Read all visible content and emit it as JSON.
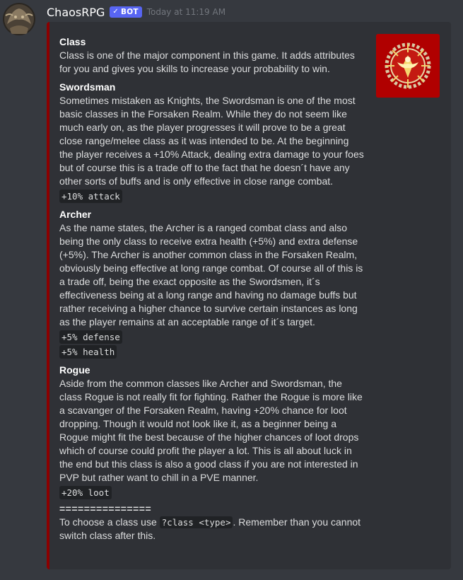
{
  "message": {
    "username": "ChaosRPG",
    "bot_tag": "BOT",
    "timestamp": "Today at 11:19 AM"
  },
  "embed": {
    "accent_color": "#8b0000",
    "thumbnail_icon": "golden-sun-emblem",
    "fields": [
      {
        "name": "Class",
        "value": "Class is one of the major component in this game. It adds attributes for you and gives you skills to increase your probability to win."
      },
      {
        "name": "Swordsman",
        "value": "Sometimes mistaken as Knights, the Swordsman is one of the most basic classes in the Forsaken Realm. While they do not seem like much early on, as the player progresses it will prove to be a great close range/melee class as it was intended to be. At the beginning the player receives a +10% Attack, dealing extra damage to your foes but of course this is a trade off to the fact that he doesn´t have any other sorts of buffs and is only effective in close range combat.",
        "codes": [
          "+10% attack"
        ]
      },
      {
        "name": "Archer",
        "value": "As the name states, the Archer is a ranged combat class and also being the only class to receive extra health (+5%) and extra defense (+5%). The Archer is another common class in the Forsaken Realm, obviously being effective at long range combat. Of course all of this is a trade off, being the exact opposite as the Swordsmen, it´s effectiveness being at a long range and having no damage buffs but rather receiving a higher chance to survive certain instances as long as the player remains at an acceptable range of it´s target.",
        "codes": [
          "+5% defense",
          "+5% health"
        ]
      },
      {
        "name": "Rogue",
        "value": "Aside from the common classes like Archer and Swordsman, the class Rogue is not really fit for fighting. Rather the Rogue is more like a scavanger of the Forsaken Realm, having +20% chance for loot dropping. Though it would not look like it, as a beginner being a Rogue might fit the best because of the higher chances of loot drops which of course could profit the player a lot. This is all about luck in the end but this class is also a good class if you are not interested in PVP but rather want to chill in a PVE manner.",
        "codes": [
          "+20% loot"
        ]
      }
    ],
    "separator": "===============",
    "footer": {
      "before": "To choose a class use ",
      "command": "?class <type>",
      "after": ". Remember than you cannot switch class after this."
    }
  }
}
